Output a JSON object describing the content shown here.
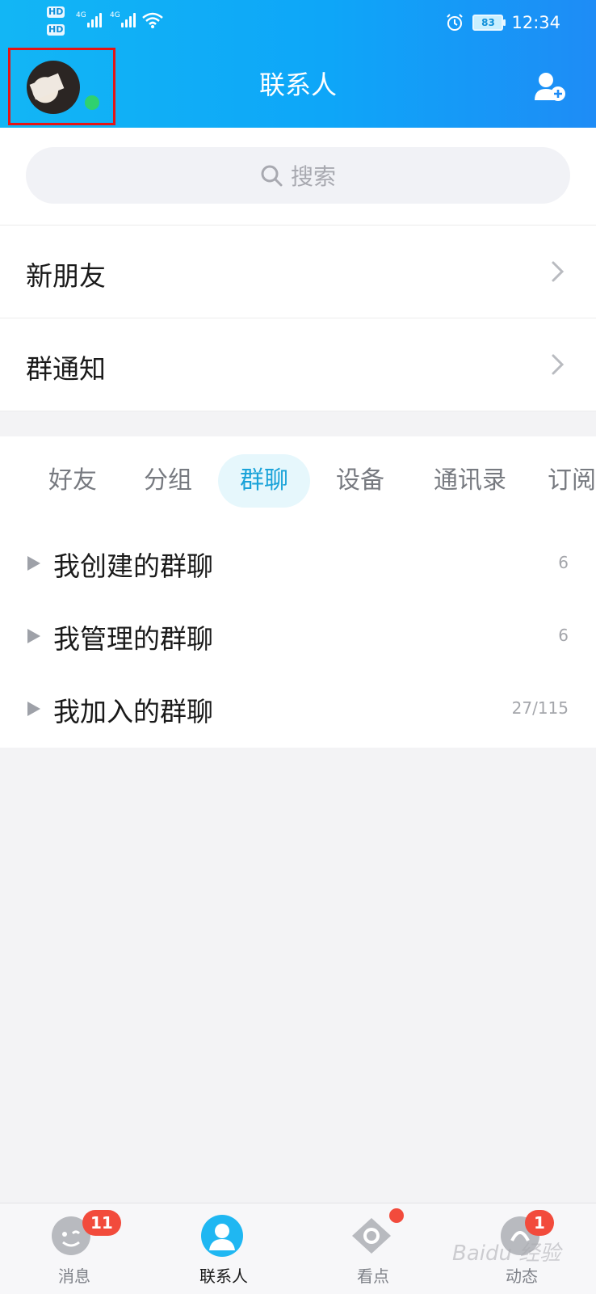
{
  "status_bar": {
    "hd_top": "HD",
    "hd_bottom": "HD",
    "signal_1": "4G",
    "signal_2": "4G",
    "battery": "83",
    "time": "12:34"
  },
  "header": {
    "title": "联系人",
    "avatar_online": true
  },
  "search": {
    "placeholder": "搜索"
  },
  "menu_rows": [
    {
      "label": "新朋友"
    },
    {
      "label": "群通知"
    }
  ],
  "tabs": [
    {
      "label": "好友",
      "active": false
    },
    {
      "label": "分组",
      "active": false
    },
    {
      "label": "群聊",
      "active": true
    },
    {
      "label": "设备",
      "active": false
    },
    {
      "label": "通讯录",
      "active": false
    },
    {
      "label": "订阅",
      "active": false
    }
  ],
  "groups": [
    {
      "label": "我创建的群聊",
      "count": "6"
    },
    {
      "label": "我管理的群聊",
      "count": "6"
    },
    {
      "label": "我加入的群聊",
      "count": "27/115"
    }
  ],
  "bottom_nav": [
    {
      "label": "消息",
      "badge": "11",
      "icon": "message-icon"
    },
    {
      "label": "联系人",
      "badge": "",
      "icon": "contacts-icon",
      "active": true
    },
    {
      "label": "看点",
      "badge": "",
      "icon": "eye-icon",
      "dot": true
    },
    {
      "label": "动态",
      "badge": "1",
      "icon": "feed-icon"
    }
  ],
  "watermark": "Baidu 经验",
  "colors": {
    "header_start": "#12b6f5",
    "header_end": "#1e8cf6",
    "accent": "#1aa3d9",
    "badge": "#f24b3c",
    "online": "#2fd16f"
  }
}
